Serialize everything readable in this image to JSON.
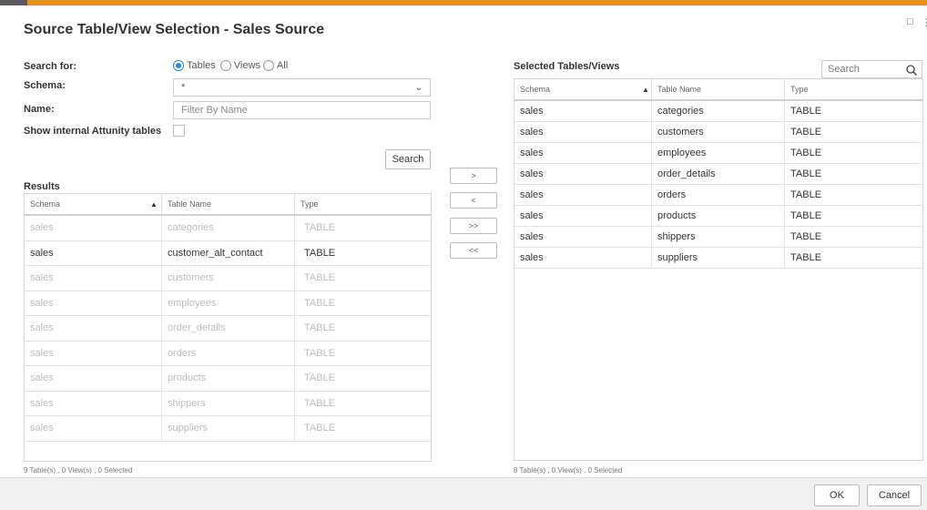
{
  "dialog": {
    "title": "Source Table/View Selection - Sales Source"
  },
  "search_form": {
    "search_for_label": "Search for:",
    "options": [
      {
        "label": "Tables",
        "checked": true
      },
      {
        "label": "Views",
        "checked": false
      },
      {
        "label": "All",
        "checked": false
      }
    ],
    "schema_label": "Schema:",
    "schema_value": "*",
    "name_label": "Name:",
    "name_placeholder": "Filter By Name",
    "show_internal_label": "Show internal Attunity tables",
    "search_button": "Search"
  },
  "results": {
    "title": "Results",
    "columns": [
      "Schema",
      "Table Name",
      "Type"
    ],
    "rows": [
      {
        "schema": "sales",
        "table": "categories",
        "type": "TABLE",
        "dim": true
      },
      {
        "schema": "sales",
        "table": "customer_alt_contact",
        "type": "TABLE",
        "dim": false
      },
      {
        "schema": "sales",
        "table": "customers",
        "type": "TABLE",
        "dim": true
      },
      {
        "schema": "sales",
        "table": "employees",
        "type": "TABLE",
        "dim": true
      },
      {
        "schema": "sales",
        "table": "order_details",
        "type": "TABLE",
        "dim": true
      },
      {
        "schema": "sales",
        "table": "orders",
        "type": "TABLE",
        "dim": true
      },
      {
        "schema": "sales",
        "table": "products",
        "type": "TABLE",
        "dim": true
      },
      {
        "schema": "sales",
        "table": "shippers",
        "type": "TABLE",
        "dim": true
      },
      {
        "schema": "sales",
        "table": "suppliers",
        "type": "TABLE",
        "dim": true
      }
    ],
    "status": "9 Table(s) , 0 View(s) , 0 Selected"
  },
  "transfer": {
    "add": ">",
    "remove": "<",
    "add_all": ">>",
    "remove_all": "<<"
  },
  "selected": {
    "title": "Selected Tables/Views",
    "search_placeholder": "Search",
    "columns": [
      "Schema",
      "Table Name",
      "Type"
    ],
    "rows": [
      {
        "schema": "sales",
        "table": "categories",
        "type": "TABLE"
      },
      {
        "schema": "sales",
        "table": "customers",
        "type": "TABLE"
      },
      {
        "schema": "sales",
        "table": "employees",
        "type": "TABLE"
      },
      {
        "schema": "sales",
        "table": "order_details",
        "type": "TABLE"
      },
      {
        "schema": "sales",
        "table": "orders",
        "type": "TABLE"
      },
      {
        "schema": "sales",
        "table": "products",
        "type": "TABLE"
      },
      {
        "schema": "sales",
        "table": "shippers",
        "type": "TABLE"
      },
      {
        "schema": "sales",
        "table": "suppliers",
        "type": "TABLE"
      }
    ],
    "status": "8 Table(s) , 0 View(s) , 0 Selected"
  },
  "footer": {
    "ok": "OK",
    "cancel": "Cancel"
  },
  "colors": {
    "accent_bar": "#e8912a",
    "radio_selected": "#2b88d8",
    "dim_text": "#bcbcbc"
  }
}
